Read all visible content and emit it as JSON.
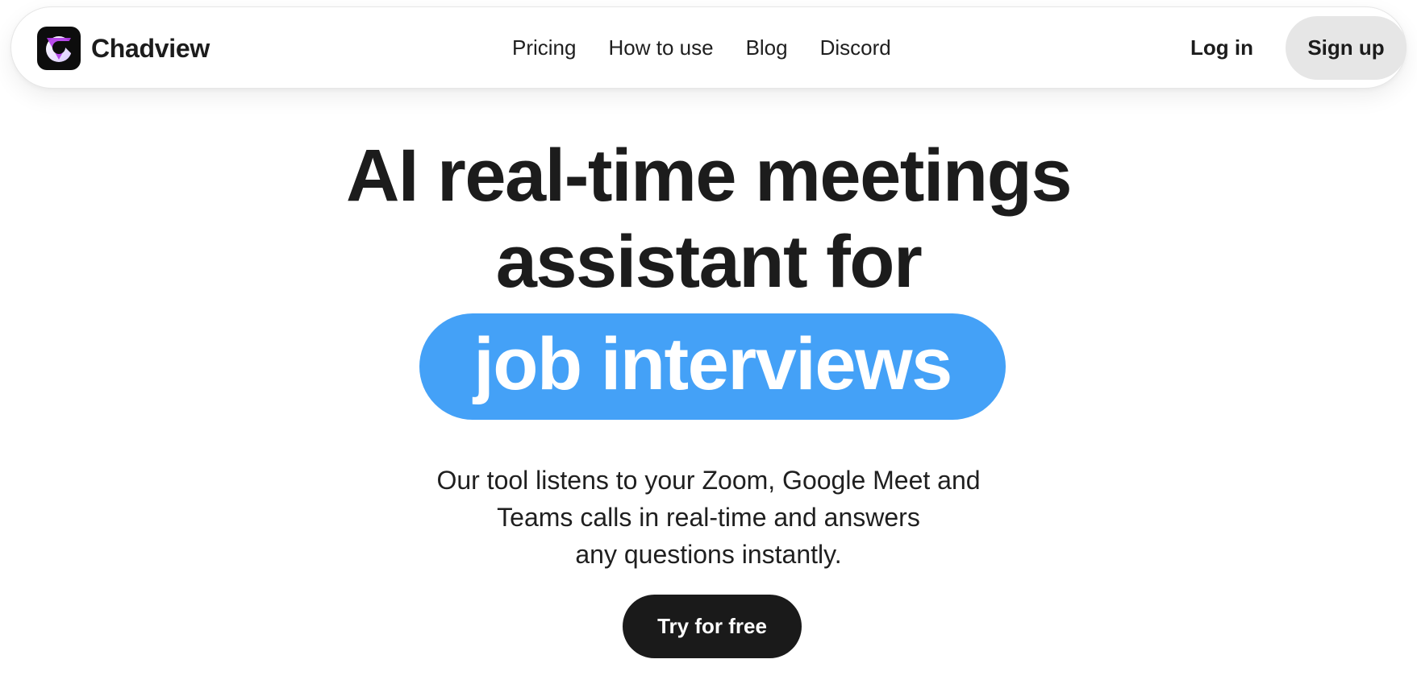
{
  "brand": {
    "name": "Chadview",
    "logo_icon": "chadview-logo-icon",
    "logo_bg": "#0d0d0d",
    "logo_accent": "#b23ce8"
  },
  "nav": {
    "links": [
      {
        "label": "Pricing"
      },
      {
        "label": "How to use"
      },
      {
        "label": "Blog"
      },
      {
        "label": "Discord"
      }
    ],
    "login_label": "Log in",
    "signup_label": "Sign up"
  },
  "hero": {
    "title_line1": "AI real-time meetings",
    "title_line2": "assistant for",
    "highlight": "job interviews",
    "highlight_color": "#44a1f7",
    "subtitle_lines": [
      "Our tool listens to your Zoom, Google Meet and",
      "Teams calls in real-time and answers",
      "any questions instantly."
    ],
    "cta_label": "Try for free"
  },
  "colors": {
    "text": "#1c1c1c",
    "signup_bg": "#e6e6e6",
    "cta_bg": "#1a1a1a"
  }
}
